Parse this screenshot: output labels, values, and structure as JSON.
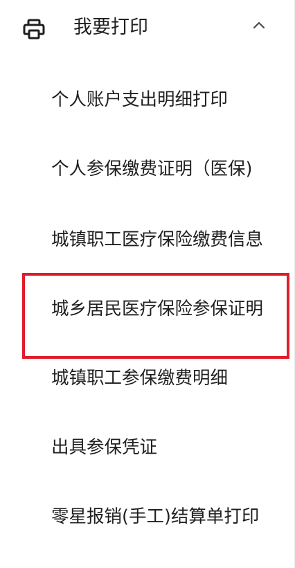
{
  "menu": {
    "title": "我要打印",
    "header_icon": "printer-icon",
    "toggle_icon": "chevron-up-icon",
    "items": [
      {
        "label": "个人账户支出明细打印"
      },
      {
        "label": "个人参保缴费证明（医保)"
      },
      {
        "label": "城镇职工医疗保险缴费信息"
      },
      {
        "label": "城乡居民医疗保险参保证明"
      },
      {
        "label": "城镇职工参保缴费明细"
      },
      {
        "label": "出具参保凭证"
      },
      {
        "label": "零星报销(手工)结算单打印"
      }
    ],
    "highlighted_item_index": 3,
    "highlight_color": "#e01c2b",
    "text_color": "#1f1f1f"
  }
}
